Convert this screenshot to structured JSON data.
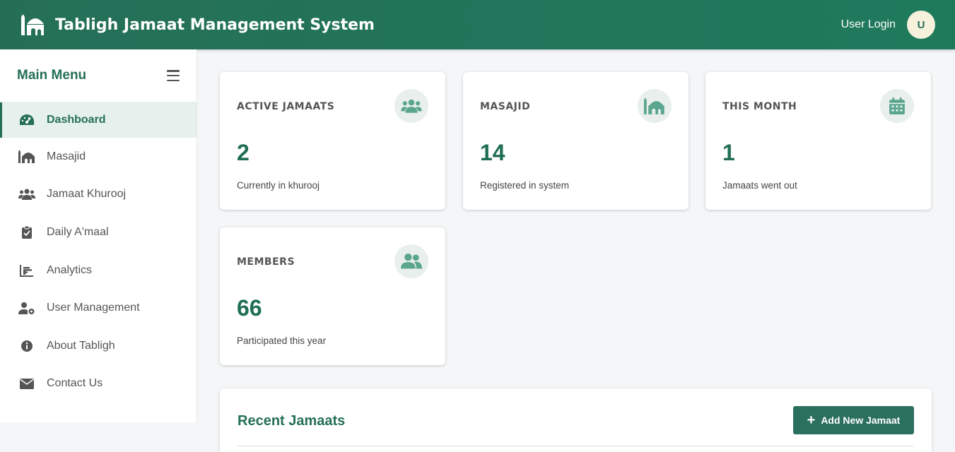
{
  "header": {
    "title": "Tabligh Jamaat Management System",
    "logo_icon": "mosque-icon",
    "login_label": "User Login",
    "avatar_initial": "U"
  },
  "sidebar": {
    "title": "Main Menu",
    "toggle_icon": "hamburger-icon",
    "items": [
      {
        "label": "Dashboard",
        "icon": "gauge-icon",
        "active": true
      },
      {
        "label": "Masajid",
        "icon": "mosque-icon",
        "active": false
      },
      {
        "label": "Jamaat Khurooj",
        "icon": "users-icon",
        "active": false
      },
      {
        "label": "Daily A'maal",
        "icon": "clipboard-icon",
        "active": false
      },
      {
        "label": "Analytics",
        "icon": "bar-chart-icon",
        "active": false
      },
      {
        "label": "User Management",
        "icon": "user-cog-icon",
        "active": false
      },
      {
        "label": "About Tabligh",
        "icon": "info-icon",
        "active": false
      },
      {
        "label": "Contact Us",
        "icon": "envelope-icon",
        "active": false
      }
    ]
  },
  "stats": [
    {
      "label": "ACTIVE JAMAATS",
      "value": "2",
      "sub": "Currently in khurooj",
      "icon": "users-icon"
    },
    {
      "label": "MASAJID",
      "value": "14",
      "sub": "Registered in system",
      "icon": "mosque-icon"
    },
    {
      "label": "THIS MONTH",
      "value": "1",
      "sub": "Jamaats went out",
      "icon": "calendar-icon"
    },
    {
      "label": "MEMBERS",
      "value": "66",
      "sub": "Participated this year",
      "icon": "user-group-icon"
    }
  ],
  "recent": {
    "title": "Recent Jamaats",
    "add_button": "Add New Jamaat"
  },
  "colors": {
    "primary": "#256f57",
    "header_bg": "#1f7a5c",
    "icon_bg": "#e8efec",
    "accent_icon": "#5aa58e",
    "page_bg": "#f4f6f8"
  }
}
